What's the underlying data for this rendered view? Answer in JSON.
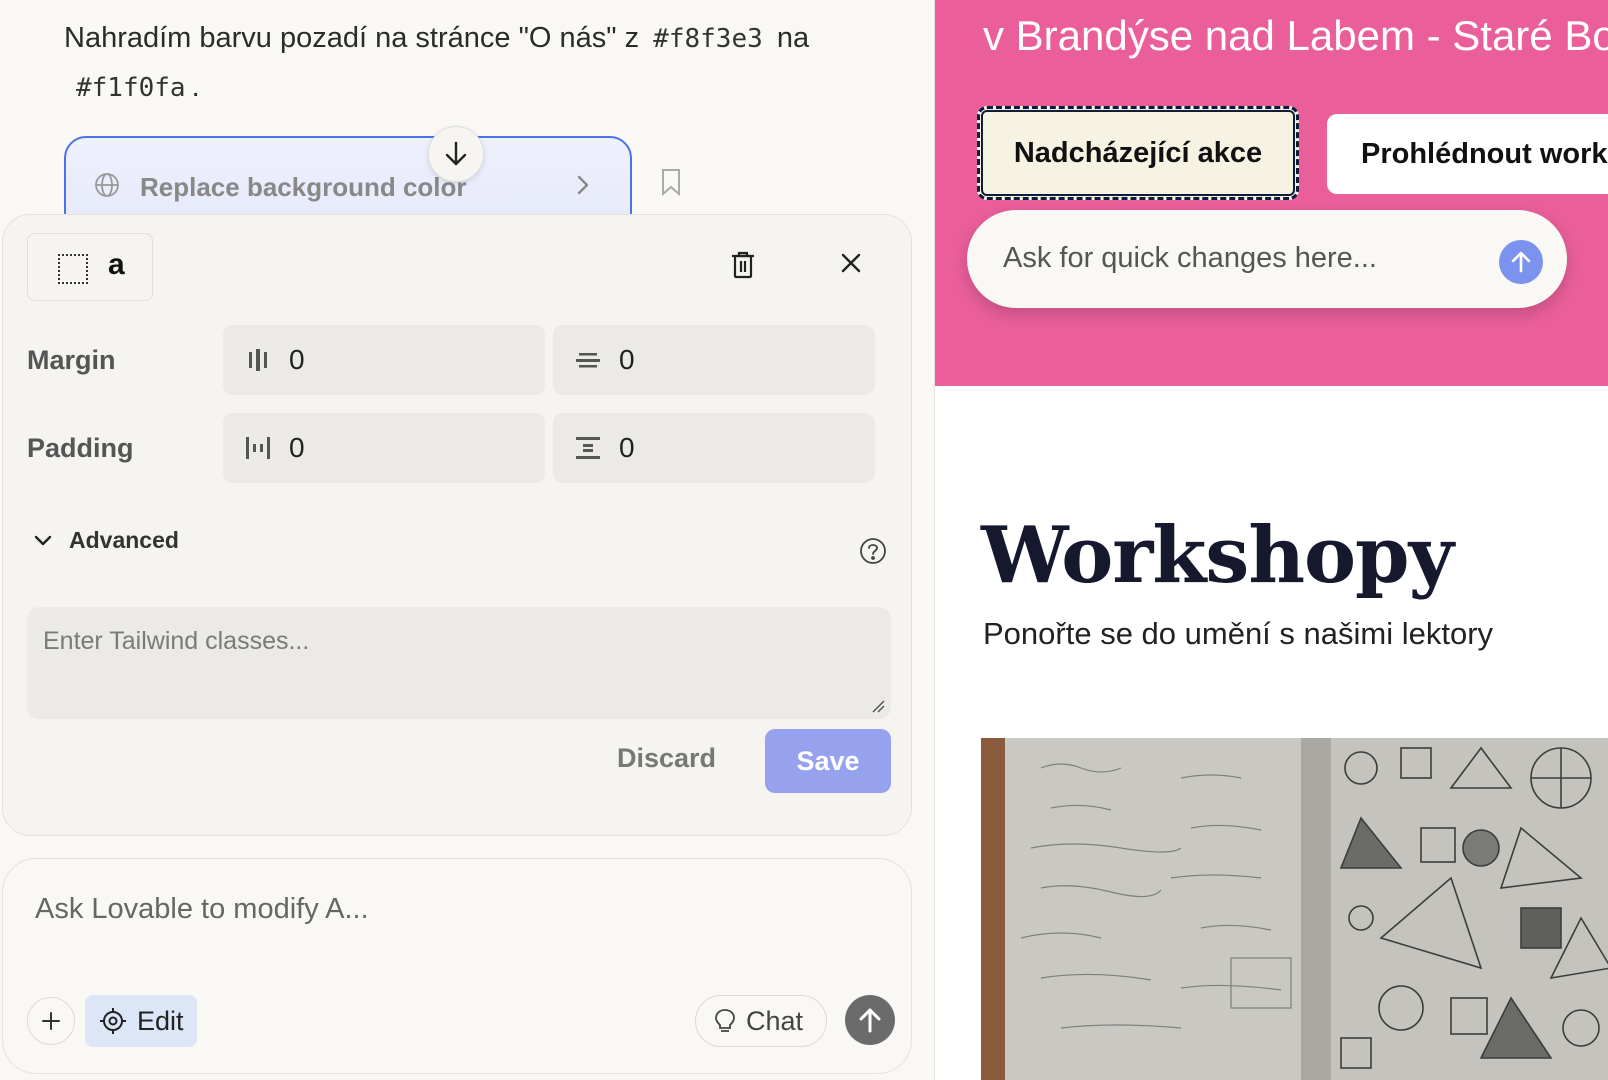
{
  "chat": {
    "message_text": "Nahradím barvu pozadí na stránce \"O nás\" z",
    "color_from": "#f8f3e3",
    "connector": "na",
    "color_to": "#f1f0fa",
    "period": ".",
    "action_label": "Replace background color"
  },
  "edit_panel": {
    "element_tag": "a",
    "margin_label": "Margin",
    "margin_x": "0",
    "margin_y": "0",
    "padding_label": "Padding",
    "padding_x": "0",
    "padding_y": "0",
    "advanced_label": "Advanced",
    "tailwind_placeholder": "Enter Tailwind classes...",
    "discard_label": "Discard",
    "save_label": "Save"
  },
  "composer": {
    "placeholder": "Ask Lovable to modify A...",
    "edit_label": "Edit",
    "chat_label": "Chat"
  },
  "preview": {
    "hero_title": "v Brandýse nad Labem - Staré Boleslavi",
    "btn_primary": "Nadcházející akce",
    "btn_secondary": "Prohlédnout workshopy",
    "quick_placeholder": "Ask for quick changes here...",
    "section_title": "Workshopy",
    "section_subtitle": "Ponořte se do umění s našimi lektory"
  },
  "colors": {
    "hero_bg": "#ea5f9a",
    "save_bg": "#97a2ee",
    "selected_btn_bg": "#f7f3e3",
    "accent": "#4a73e8"
  }
}
